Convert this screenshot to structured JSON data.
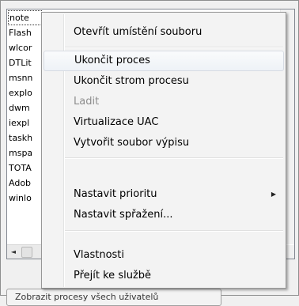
{
  "process_list": {
    "rows": [
      "note",
      "Flash",
      "wlcor",
      "DTLit",
      "msnn",
      "explo",
      "dwm",
      "iexpl",
      "taskh",
      "mspa",
      "TOTA",
      "Adob",
      "winlo"
    ]
  },
  "scrollbar": {
    "left_arrow": "◄"
  },
  "bottom_button": {
    "label": "Zobrazit procesy všech uživatelů"
  },
  "context_menu": {
    "items": [
      {
        "label": "Otevřít umístění souboru",
        "enabled": true
      },
      {
        "label": "Ukončit proces",
        "enabled": true,
        "highlighted": true
      },
      {
        "label": "Ukončit strom procesu",
        "enabled": true
      },
      {
        "label": "Ladit",
        "enabled": false
      },
      {
        "label": "Virtualizace UAC",
        "enabled": true
      },
      {
        "label": "Vytvořit soubor výpisu",
        "enabled": true
      },
      {
        "label": "Nastavit prioritu",
        "enabled": true,
        "submenu": true
      },
      {
        "label": "Nastavit spřažení...",
        "enabled": true
      },
      {
        "label": "Vlastnosti",
        "enabled": true
      },
      {
        "label": "Přejít ke službě",
        "enabled": true
      }
    ],
    "submenu_arrow": "▶"
  }
}
